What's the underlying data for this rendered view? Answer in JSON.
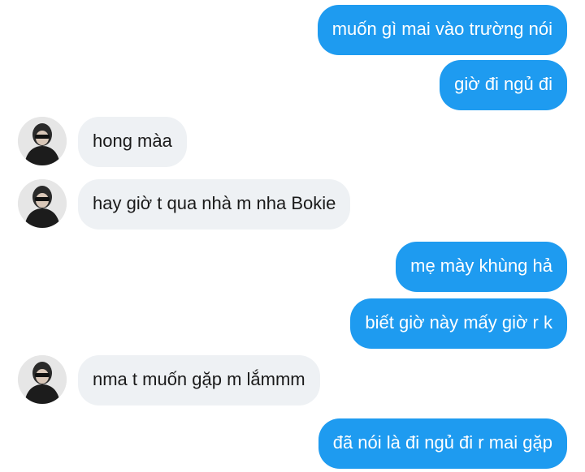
{
  "conversation": {
    "messages": [
      {
        "side": "out",
        "text": "muốn gì mai vào trường nói"
      },
      {
        "side": "out",
        "text": "giờ đi ngủ đi"
      },
      {
        "side": "in",
        "text": "hong màa",
        "avatar": "contact-avatar"
      },
      {
        "side": "in",
        "text": "hay giờ t qua nhà m nha Bokie",
        "avatar": "contact-avatar"
      },
      {
        "side": "out",
        "text": "mẹ mày khùng hả"
      },
      {
        "side": "out",
        "text": "biết giờ này mấy giờ r k"
      },
      {
        "side": "in",
        "text": "nma t muốn gặp m lắmmm",
        "avatar": "contact-avatar"
      },
      {
        "side": "out",
        "text": "đã nói là đi ngủ đi r mai gặp"
      }
    ]
  },
  "colors": {
    "outgoing_bubble": "#1e9bf0",
    "incoming_bubble": "#eef1f4",
    "outgoing_text": "#ffffff",
    "incoming_text": "#1a1a1a"
  }
}
